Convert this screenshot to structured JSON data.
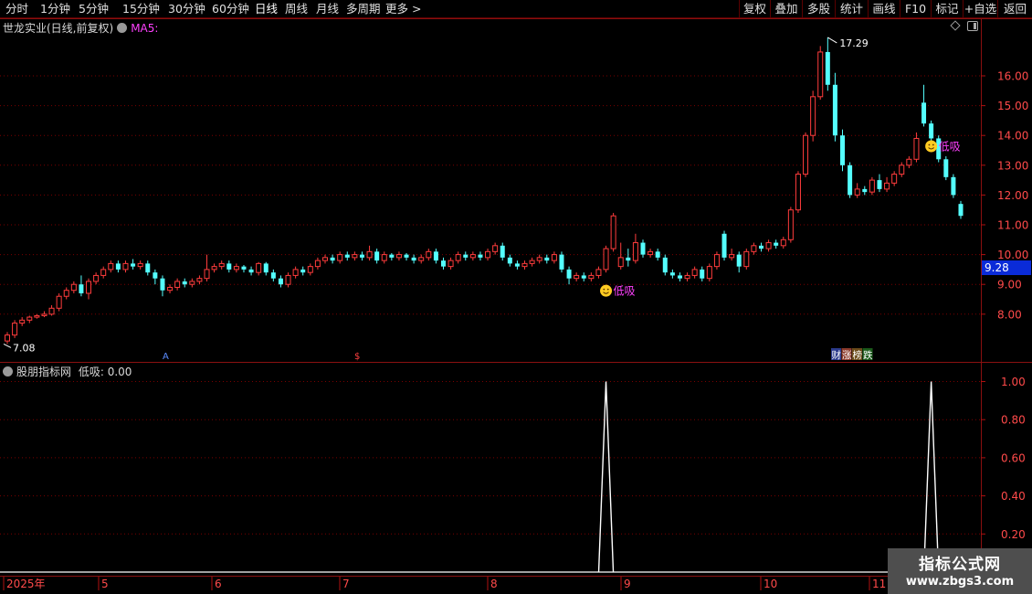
{
  "toolbar": {
    "left_items": [
      "分时",
      "1分钟",
      "5分钟",
      "15分钟",
      "30分钟",
      "60分钟",
      "日线",
      "周线",
      "月线",
      "多周期",
      "更多 >"
    ],
    "active_item": "日线",
    "right_items": [
      "复权",
      "叠加",
      "多股",
      "统计",
      "画线",
      "F10",
      "标记",
      "+自选",
      "返回"
    ]
  },
  "main_pane": {
    "title": "世龙实业(日线,前复权)",
    "ma_label": "MA5:",
    "price_labels": [
      "16.00",
      "15.00",
      "14.00",
      "13.00",
      "12.00",
      "11.00",
      "10.00",
      "9.00",
      "8.00"
    ],
    "current_price": "9.28",
    "high_marker": "17.29",
    "low_marker": "7.08",
    "signal_label": "低吸",
    "event_markers": [
      "财",
      "涨",
      "榜",
      "跌"
    ],
    "mini_marker_1": "A",
    "mini_marker_2": "$"
  },
  "sub_pane": {
    "title": "股朋指标网",
    "indicator_label": "低吸:",
    "indicator_value": "0.00",
    "y_labels": [
      "1.00",
      "0.80",
      "0.60",
      "0.40",
      "0.20"
    ]
  },
  "time_axis": {
    "labels": [
      "2025年",
      "5",
      "6",
      "7",
      "8",
      "9",
      "10",
      "11"
    ]
  },
  "watermark": {
    "line1": "指标公式网",
    "line2": "www.zbgs3.com"
  },
  "colors": {
    "up": "#ff3c3c",
    "down": "#54ffff",
    "ma5": "#ff40ff",
    "signal": "#ff40ff",
    "grid": "#7a0000",
    "axis": "#b01010"
  },
  "chart_data": {
    "type": "candlestick",
    "ylim": [
      7.0,
      17.6
    ],
    "candles": [
      [
        7.1,
        7.3,
        7.4,
        7.0
      ],
      [
        7.3,
        7.7,
        7.8,
        7.2
      ],
      [
        7.7,
        7.8,
        7.9,
        7.6
      ],
      [
        7.8,
        7.9,
        7.95,
        7.7
      ],
      [
        7.9,
        7.95,
        8.0,
        7.85
      ],
      [
        7.95,
        8.0,
        8.1,
        7.9
      ],
      [
        8.0,
        8.2,
        8.3,
        7.95
      ],
      [
        8.2,
        8.6,
        8.7,
        8.1
      ],
      [
        8.6,
        8.8,
        8.9,
        8.5
      ],
      [
        8.8,
        9.0,
        9.1,
        8.7
      ],
      [
        9.0,
        8.7,
        9.3,
        8.6
      ],
      [
        8.7,
        9.1,
        9.2,
        8.5
      ],
      [
        9.1,
        9.3,
        9.4,
        9.0
      ],
      [
        9.3,
        9.5,
        9.6,
        9.2
      ],
      [
        9.5,
        9.7,
        9.8,
        9.4
      ],
      [
        9.7,
        9.5,
        9.8,
        9.4
      ],
      [
        9.5,
        9.7,
        9.8,
        9.4
      ],
      [
        9.7,
        9.6,
        9.85,
        9.5
      ],
      [
        9.6,
        9.7,
        9.8,
        9.5
      ],
      [
        9.7,
        9.4,
        9.8,
        9.3
      ],
      [
        9.4,
        9.2,
        9.5,
        9.0
      ],
      [
        9.2,
        8.8,
        9.3,
        8.6
      ],
      [
        8.8,
        8.9,
        9.0,
        8.7
      ],
      [
        8.9,
        9.1,
        9.2,
        8.8
      ],
      [
        9.1,
        9.0,
        9.2,
        8.9
      ],
      [
        9.0,
        9.1,
        9.2,
        8.9
      ],
      [
        9.1,
        9.2,
        9.3,
        9.0
      ],
      [
        9.2,
        9.5,
        10.0,
        9.1
      ],
      [
        9.5,
        9.6,
        9.7,
        9.4
      ],
      [
        9.6,
        9.7,
        9.8,
        9.5
      ],
      [
        9.7,
        9.5,
        9.8,
        9.4
      ],
      [
        9.5,
        9.6,
        9.7,
        9.4
      ],
      [
        9.6,
        9.5,
        9.65,
        9.4
      ],
      [
        9.5,
        9.4,
        9.6,
        9.3
      ],
      [
        9.4,
        9.7,
        9.75,
        9.3
      ],
      [
        9.7,
        9.4,
        9.75,
        9.3
      ],
      [
        9.4,
        9.2,
        9.5,
        9.1
      ],
      [
        9.2,
        9.0,
        9.3,
        8.9
      ],
      [
        9.0,
        9.3,
        9.4,
        8.9
      ],
      [
        9.3,
        9.5,
        9.6,
        9.2
      ],
      [
        9.5,
        9.4,
        9.6,
        9.3
      ],
      [
        9.4,
        9.6,
        9.7,
        9.3
      ],
      [
        9.6,
        9.8,
        9.9,
        9.5
      ],
      [
        9.8,
        9.9,
        10.0,
        9.7
      ],
      [
        9.9,
        9.8,
        10.0,
        9.7
      ],
      [
        9.8,
        10.0,
        10.1,
        9.7
      ],
      [
        10.0,
        9.9,
        10.1,
        9.8
      ],
      [
        9.9,
        10.0,
        10.1,
        9.8
      ],
      [
        10.0,
        9.9,
        10.1,
        9.8
      ],
      [
        9.9,
        10.1,
        10.3,
        9.8
      ],
      [
        10.1,
        9.8,
        10.2,
        9.7
      ],
      [
        9.8,
        10.0,
        10.1,
        9.7
      ],
      [
        10.0,
        9.9,
        10.05,
        9.8
      ],
      [
        9.9,
        10.0,
        10.1,
        9.8
      ],
      [
        10.0,
        9.9,
        10.05,
        9.8
      ],
      [
        9.9,
        9.8,
        10.0,
        9.7
      ],
      [
        9.8,
        9.9,
        10.0,
        9.7
      ],
      [
        9.9,
        10.1,
        10.2,
        9.8
      ],
      [
        10.1,
        9.8,
        10.2,
        9.7
      ],
      [
        9.8,
        9.6,
        9.9,
        9.5
      ],
      [
        9.6,
        9.8,
        9.9,
        9.5
      ],
      [
        9.8,
        10.0,
        10.1,
        9.7
      ],
      [
        10.0,
        9.9,
        10.1,
        9.8
      ],
      [
        9.9,
        10.0,
        10.1,
        9.8
      ],
      [
        10.0,
        9.9,
        10.1,
        9.8
      ],
      [
        9.9,
        10.1,
        10.2,
        9.8
      ],
      [
        10.1,
        10.3,
        10.4,
        10.0
      ],
      [
        10.3,
        9.9,
        10.4,
        9.8
      ],
      [
        9.9,
        9.7,
        10.0,
        9.6
      ],
      [
        9.7,
        9.6,
        9.8,
        9.5
      ],
      [
        9.6,
        9.7,
        9.8,
        9.5
      ],
      [
        9.7,
        9.8,
        9.9,
        9.6
      ],
      [
        9.8,
        9.9,
        10.0,
        9.7
      ],
      [
        9.9,
        9.8,
        10.0,
        9.7
      ],
      [
        9.8,
        10.0,
        10.1,
        9.7
      ],
      [
        10.0,
        9.5,
        10.1,
        9.4
      ],
      [
        9.5,
        9.2,
        9.6,
        9.0
      ],
      [
        9.2,
        9.3,
        9.4,
        9.1
      ],
      [
        9.3,
        9.2,
        9.4,
        9.1
      ],
      [
        9.2,
        9.3,
        9.4,
        9.1
      ],
      [
        9.3,
        9.5,
        9.6,
        9.2
      ],
      [
        9.5,
        10.2,
        10.3,
        9.4
      ],
      [
        10.2,
        11.3,
        11.4,
        10.1
      ],
      [
        9.6,
        9.9,
        10.4,
        9.5
      ],
      [
        9.9,
        9.8,
        10.2,
        9.6
      ],
      [
        9.8,
        10.4,
        10.7,
        9.7
      ],
      [
        10.4,
        10.0,
        10.5,
        9.9
      ],
      [
        10.0,
        10.1,
        10.2,
        9.9
      ],
      [
        10.1,
        9.9,
        10.2,
        9.8
      ],
      [
        9.9,
        9.4,
        10.0,
        9.3
      ],
      [
        9.4,
        9.3,
        9.5,
        9.2
      ],
      [
        9.3,
        9.2,
        9.4,
        9.1
      ],
      [
        9.2,
        9.3,
        9.4,
        9.1
      ],
      [
        9.3,
        9.5,
        9.6,
        9.2
      ],
      [
        9.5,
        9.2,
        9.6,
        9.1
      ],
      [
        9.2,
        9.6,
        9.7,
        9.1
      ],
      [
        9.6,
        10.0,
        10.1,
        9.5
      ],
      [
        10.7,
        9.9,
        10.8,
        9.8
      ],
      [
        9.9,
        10.0,
        10.2,
        9.8
      ],
      [
        10.0,
        9.6,
        10.1,
        9.4
      ],
      [
        9.6,
        10.1,
        10.2,
        9.5
      ],
      [
        10.1,
        10.3,
        10.4,
        10.0
      ],
      [
        10.3,
        10.2,
        10.4,
        10.1
      ],
      [
        10.2,
        10.4,
        10.5,
        10.1
      ],
      [
        10.4,
        10.3,
        10.5,
        10.2
      ],
      [
        10.3,
        10.5,
        10.6,
        10.2
      ],
      [
        10.5,
        11.5,
        11.6,
        10.4
      ],
      [
        11.5,
        12.7,
        12.8,
        11.4
      ],
      [
        12.7,
        14.0,
        14.1,
        12.6
      ],
      [
        14.0,
        15.3,
        15.5,
        13.8
      ],
      [
        15.3,
        16.8,
        17.0,
        15.2
      ],
      [
        16.8,
        15.7,
        17.29,
        15.5
      ],
      [
        15.7,
        14.0,
        16.1,
        13.8
      ],
      [
        14.0,
        13.0,
        14.2,
        12.8
      ],
      [
        13.0,
        12.0,
        13.1,
        11.9
      ],
      [
        12.0,
        12.2,
        12.4,
        11.9
      ],
      [
        12.2,
        12.1,
        12.3,
        12.0
      ],
      [
        12.1,
        12.5,
        12.6,
        12.0
      ],
      [
        12.5,
        12.2,
        12.7,
        12.1
      ],
      [
        12.2,
        12.4,
        12.6,
        12.1
      ],
      [
        12.4,
        12.7,
        12.8,
        12.3
      ],
      [
        12.7,
        13.0,
        13.1,
        12.6
      ],
      [
        13.0,
        13.2,
        13.3,
        12.9
      ],
      [
        13.2,
        13.9,
        14.1,
        13.1
      ],
      [
        15.1,
        14.4,
        15.7,
        14.3
      ],
      [
        14.4,
        13.9,
        14.5,
        13.7
      ],
      [
        13.9,
        13.2,
        14.0,
        13.1
      ],
      [
        13.2,
        12.6,
        13.3,
        12.5
      ],
      [
        12.6,
        12.0,
        12.7,
        11.9
      ],
      [
        11.7,
        11.3,
        11.8,
        11.2
      ]
    ],
    "signals": [
      {
        "index": 81,
        "value": 1.0
      },
      {
        "index": 125,
        "value": 1.0
      }
    ]
  }
}
